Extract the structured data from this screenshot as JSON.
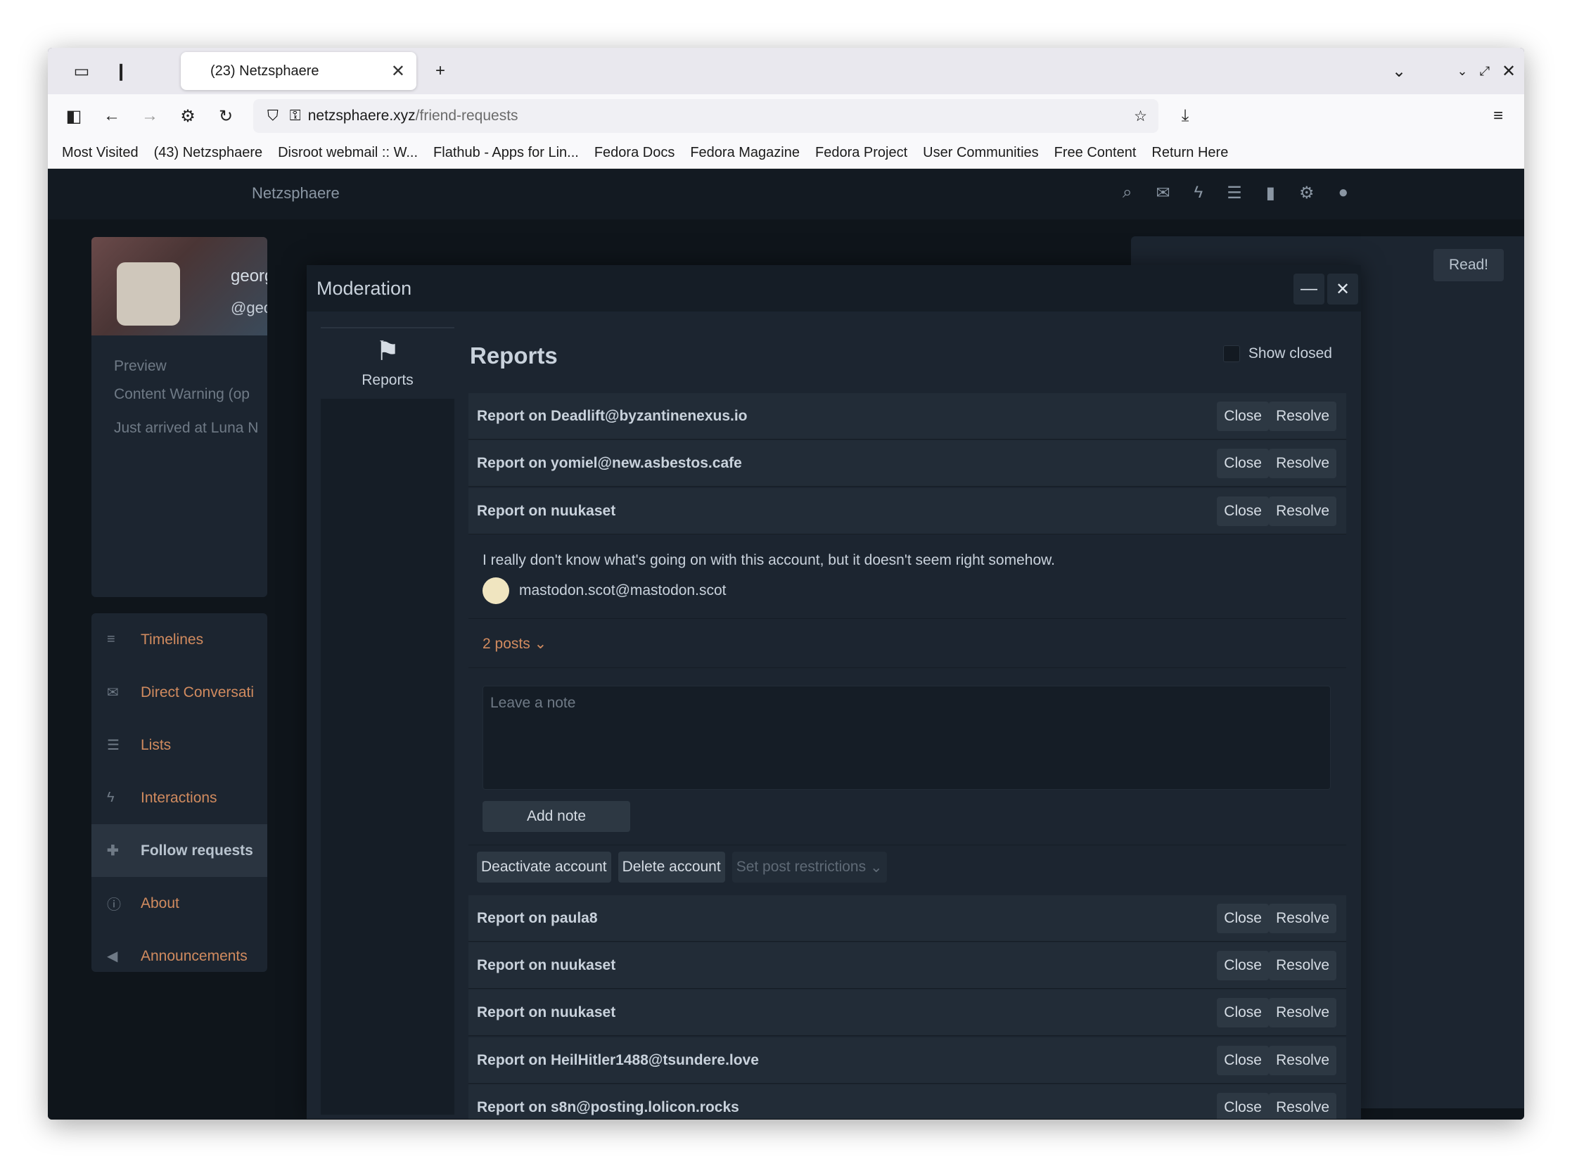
{
  "browser": {
    "tab_title": "(23) Netzsphaere",
    "url_domain": "netzsphaere.xyz",
    "url_path": "/friend-requests",
    "bookmarks": [
      "Most Visited",
      "(43) Netzsphaere",
      "Disroot webmail :: W...",
      "Flathub - Apps for Lin...",
      "Fedora Docs",
      "Fedora Magazine",
      "Fedora Project",
      "User Communities",
      "Free Content",
      "Return Here"
    ]
  },
  "site": {
    "brand": "Netzsphaere",
    "profile": {
      "name": "georgia",
      "handle": "@georgia"
    },
    "composer": {
      "preview": "Preview",
      "cw": "Content Warning (op",
      "text": "Just arrived at Luna N"
    },
    "nav": [
      "Timelines",
      "Direct Conversati",
      "Lists",
      "Interactions",
      "Follow requests",
      "About",
      "Announcements"
    ],
    "right_panel": {
      "read_button": "Read!"
    }
  },
  "modal": {
    "title": "Moderation",
    "minimize": "—",
    "close": "✕",
    "side_tab": "Reports",
    "heading": "Reports",
    "show_closed": "Show closed",
    "close_label": "Close",
    "resolve_label": "Resolve",
    "reports": [
      "Report on Deadlift@byzantinenexus.io",
      "Report on yomiel@new.asbestos.cafe",
      "Report on nuukaset",
      "Report on paula8",
      "Report on nuukaset",
      "Report on nuukaset",
      "Report on HeilHitler1488@tsundere.love",
      "Report on s8n@posting.lolicon.rocks"
    ],
    "detail": {
      "message": "I really don't know what's going on with this account, but it doesn't seem right somehow.",
      "reporter": "mastodon.scot@mastodon.scot",
      "posts": "2 posts",
      "note_placeholder": "Leave a note",
      "add_note": "Add note",
      "deactivate": "Deactivate account",
      "delete": "Delete account",
      "restrict": "Set post restrictions"
    }
  }
}
